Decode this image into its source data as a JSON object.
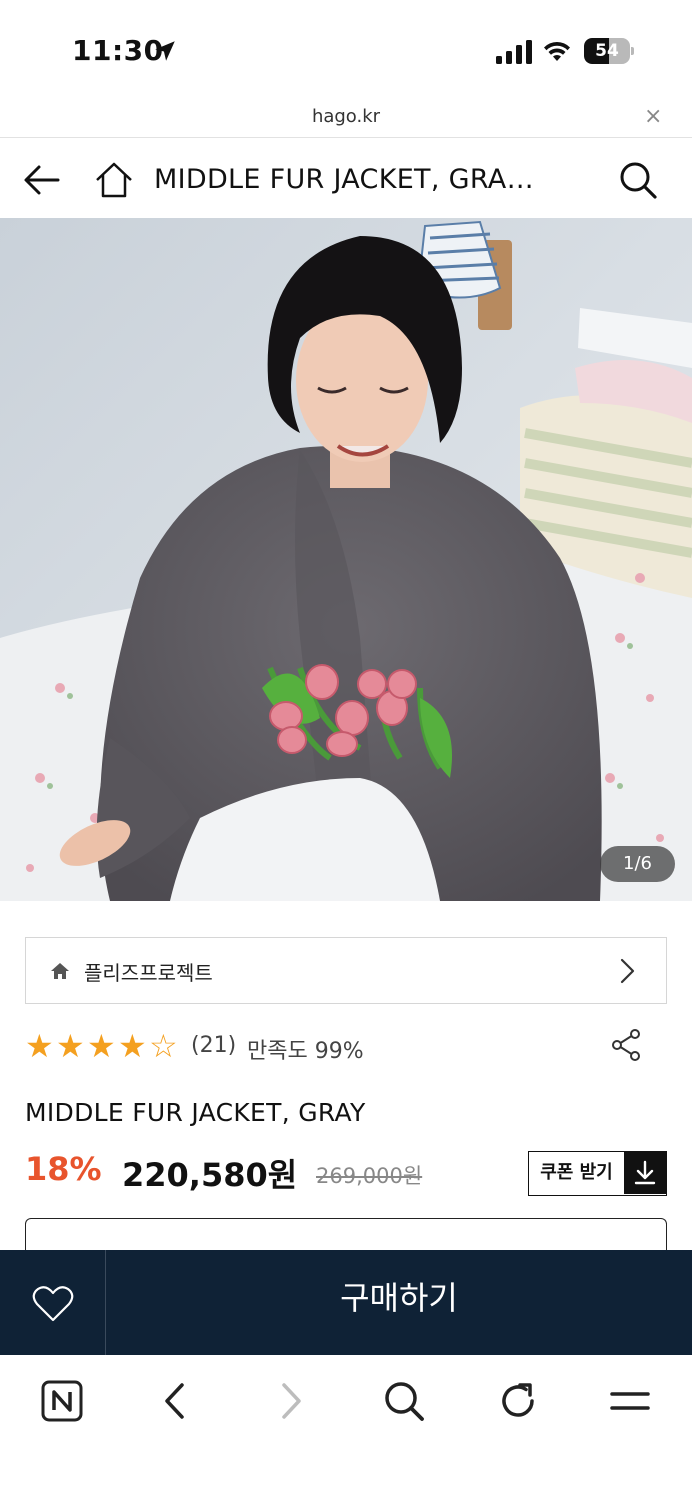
{
  "status_bar": {
    "time": "11:30",
    "battery_level": "54",
    "battery_percent": 54
  },
  "browser": {
    "url": "hago.kr",
    "close_icon": "close-icon",
    "close_glyph": "×"
  },
  "header": {
    "title": "MIDDLE FUR JACKET, GRAY",
    "title_display": "MIDDLE FUR JACKET, GRA…"
  },
  "gallery": {
    "counter": "1/6",
    "current": 1,
    "total": 6
  },
  "shop": {
    "name": "플리즈프로젝트"
  },
  "rating": {
    "stars_value": 4.5,
    "stars_max": 5,
    "review_count": "(21)",
    "satisfaction": "만족도 99%",
    "accent_color": "#f4a020"
  },
  "product": {
    "name": "MIDDLE FUR JACKET, GRAY",
    "discount": "18%",
    "price": "220,580원",
    "original_price": "269,000원",
    "discount_color": "#e8542d"
  },
  "coupon": {
    "label": "쿠폰 받기",
    "icon": "download-icon"
  },
  "purchase_bar": {
    "buy_label": "구매하기",
    "wish_icon": "heart-icon",
    "background": "#0f2236"
  },
  "toolbar": {
    "items": [
      "naver-icon",
      "back-icon",
      "forward-icon",
      "search-icon",
      "reload-icon",
      "menu-icon"
    ]
  }
}
